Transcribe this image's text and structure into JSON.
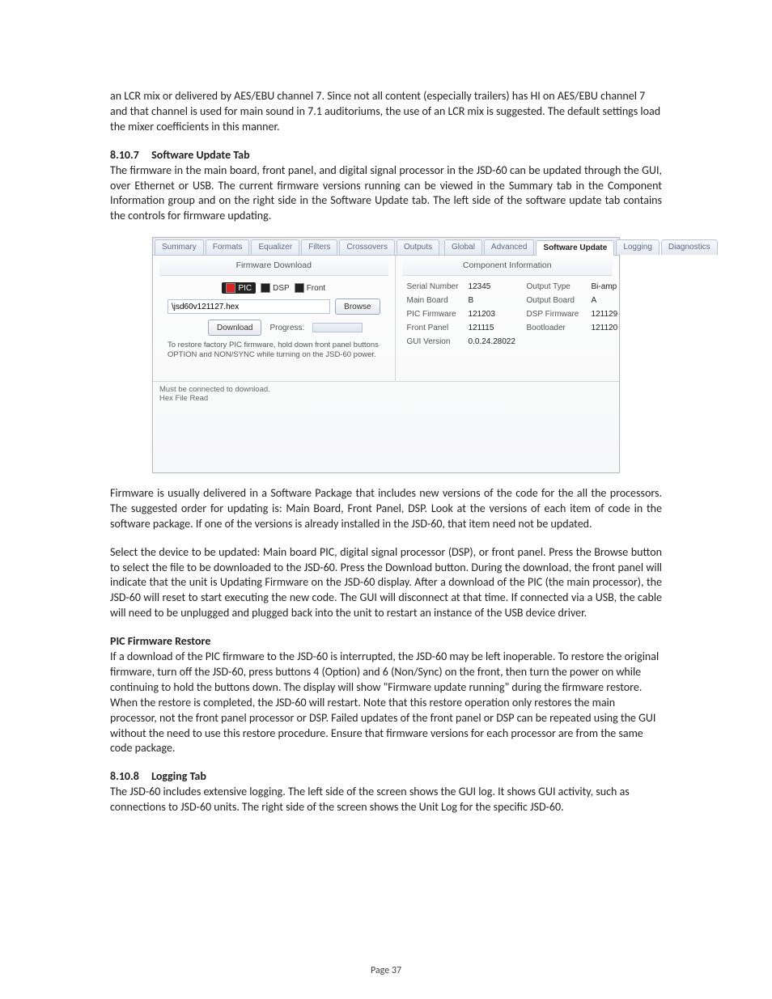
{
  "para_intro": "an LCR mix or delivered by AES/EBU channel 7. Since not all content (especially trailers) has HI on AES/EBU channel 7 and that channel is used for main sound in 7.1 auditoriums, the use of an LCR mix is suggested. The default settings load the mixer coefficients in this manner.",
  "h1": {
    "num": "8.10.7",
    "title": "Software Update Tab"
  },
  "para_h1": "The firmware in the main board, front panel, and digital signal processor in the JSD-60 can be updated through the GUI, over Ethernet or USB. The current firmware versions running can be viewed in the Summary tab in the Component Information group and on the right side in the Software Update tab. The left side of the software update tab contains the controls for firmware updating.",
  "shot": {
    "tabs": [
      "Summary",
      "Formats",
      "Equalizer",
      "Filters",
      "Crossovers",
      "Outputs",
      "Global",
      "Advanced",
      "Software Update",
      "Logging",
      "Diagnostics"
    ],
    "tab_active_index": 8,
    "left": {
      "title": "Firmware Download",
      "chips": {
        "pic": "PIC",
        "dsp": "DSP",
        "front": "Front"
      },
      "file_value": "\\jsd60v121127.hex",
      "browse": "Browse",
      "download": "Download",
      "progress_label": "Progress:",
      "hint": "To restore factory PIC firmware, hold down front panel buttons OPTION  and NON/SYNC while turning on the JSD-60 power."
    },
    "status": {
      "l1": "Must be connected to download.",
      "l2": "Hex File Read"
    },
    "right": {
      "title": "Component Information",
      "rows": [
        {
          "k1": "Serial Number",
          "v1": "12345",
          "k2": "Output Type",
          "v2": "Bi-amp"
        },
        {
          "k1": "Main Board",
          "v1": "B",
          "k2": "Output Board",
          "v2": "A"
        },
        {
          "k1": "PIC Firmware",
          "v1": "121203",
          "k2": "DSP Firmware",
          "v2": "121129"
        },
        {
          "k1": "Front Panel",
          "v1": "121115",
          "k2": "Bootloader",
          "v2": "121120"
        },
        {
          "k1": "GUI Version",
          "v1": "0.0.24.28022",
          "k2": "",
          "v2": ""
        }
      ]
    }
  },
  "para_after1": "Firmware is usually delivered in a Software Package that includes new versions of the code for the all the processors.  The suggested order for updating is: Main Board, Front Panel, DSP.  Look at the versions of each item of code in the software package. If one of the versions is already installed in the JSD-60, that item need not be updated.",
  "para_after2": "Select the device to be updated: Main board PIC, digital signal processor (DSP), or front panel. Press the Browse button to select the file to be downloaded to the JSD-60.  Press the Download button. During the download, the front panel will indicate that the unit is Updating Firmware on the JSD-60 display. After a download of the PIC (the main processor), the JSD-60 will reset to start executing the new code. The GUI will disconnect at that time. If connected via a USB, the cable will need to be unplugged and plugged back into the unit to restart an instance of the USB device driver.",
  "sub1": "PIC Firmware Restore",
  "para_sub1": "If a download of the PIC firmware to the JSD-60 is interrupted, the JSD-60 may be left inoperable. To restore the original firmware, turn off the JSD-60, press buttons 4 (Option) and 6 (Non/Sync) on the front, then turn the power on while continuing to hold the buttons down. The display will show \"Firmware update running\" during the firmware restore. When the restore is completed, the JSD-60 will restart. Note that this restore operation only restores the main processor, not the front panel processor or DSP. Failed updates of the front panel or DSP can be repeated using the GUI without the need to use this restore procedure. Ensure that firmware versions for each processor are from the same code package.",
  "h2": {
    "num": "8.10.8",
    "title": "Logging Tab"
  },
  "para_h2": "The JSD-60 includes extensive logging. The left side of the screen shows the GUI log. It shows GUI activity, such as connections to JSD-60 units. The right side of the screen shows the Unit Log for the specific JSD-60.",
  "page_number": "Page 37"
}
